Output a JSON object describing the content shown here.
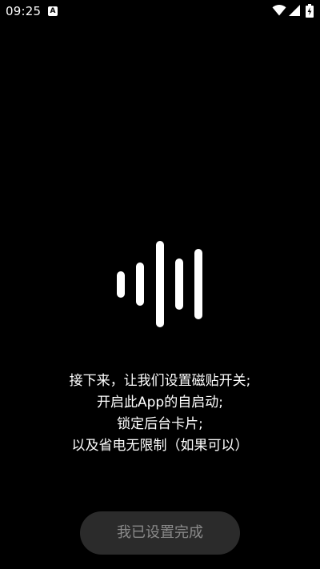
{
  "status_bar": {
    "time": "09:25",
    "notification_icon": "font-a-icon",
    "notification_glyph": "A",
    "icons": [
      "wifi-icon",
      "signal-icon",
      "battery-charging-icon"
    ]
  },
  "waveform": {
    "icon": "sound-wave-icon",
    "color": "#ffffff"
  },
  "instructions": {
    "lines": [
      "接下来，让我们设置磁贴开关;",
      "开启此App的自启动;",
      "锁定后台卡片;",
      "以及省电无限制（如果可以）"
    ]
  },
  "done_button": {
    "label": "我已设置完成",
    "background": "#2b2b2b",
    "text_color": "#8a8a8a"
  },
  "colors": {
    "background": "#000000",
    "foreground": "#ffffff"
  }
}
